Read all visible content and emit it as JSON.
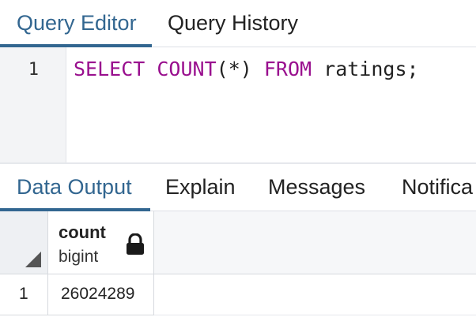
{
  "top_tabs": [
    {
      "label": "Query Editor",
      "active": true
    },
    {
      "label": "Query History",
      "active": false
    }
  ],
  "editor": {
    "line_number": "1",
    "keywords": {
      "select": "SELECT",
      "count": "COUNT",
      "from": "FROM"
    },
    "count_arg": "(*)",
    "table": "ratings;"
  },
  "bottom_tabs": [
    {
      "label": "Data Output",
      "active": true
    },
    {
      "label": "Explain",
      "active": false
    },
    {
      "label": "Messages",
      "active": false
    },
    {
      "label": "Notifica",
      "active": false
    }
  ],
  "grid": {
    "columns": [
      {
        "name": "count",
        "type": "bigint",
        "icon": "lock-icon"
      }
    ],
    "rows": [
      {
        "row_number": "1",
        "values": [
          "26024289"
        ]
      }
    ]
  },
  "colors": {
    "accent": "#326690",
    "keyword": "#990f8e"
  }
}
